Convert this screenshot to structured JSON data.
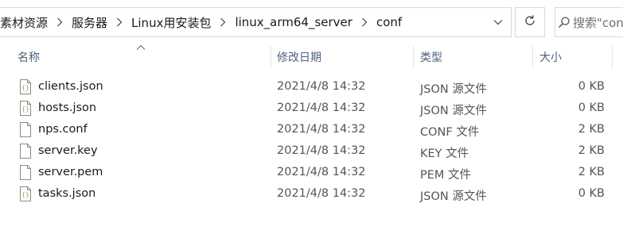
{
  "breadcrumb": {
    "items": [
      "素材资源",
      "服务器",
      "Linux用安装包",
      "linux_arm64_server",
      "conf"
    ]
  },
  "search": {
    "placeholder": "搜索\"conf\""
  },
  "columns": {
    "name": "名称",
    "date": "修改日期",
    "type": "类型",
    "size": "大小"
  },
  "files": [
    {
      "name": "clients.json",
      "date": "2021/4/8 14:32",
      "type": "JSON 源文件",
      "size": "0 KB",
      "icon": "json-file-icon"
    },
    {
      "name": "hosts.json",
      "date": "2021/4/8 14:32",
      "type": "JSON 源文件",
      "size": "0 KB",
      "icon": "json-file-icon"
    },
    {
      "name": "nps.conf",
      "date": "2021/4/8 14:32",
      "type": "CONF 文件",
      "size": "2 KB",
      "icon": "file-icon"
    },
    {
      "name": "server.key",
      "date": "2021/4/8 14:32",
      "type": "KEY 文件",
      "size": "2 KB",
      "icon": "file-icon"
    },
    {
      "name": "server.pem",
      "date": "2021/4/8 14:32",
      "type": "PEM 文件",
      "size": "2 KB",
      "icon": "file-icon"
    },
    {
      "name": "tasks.json",
      "date": "2021/4/8 14:32",
      "type": "JSON 源文件",
      "size": "0 KB",
      "icon": "json-file-icon"
    }
  ],
  "colors": {
    "header_text": "#4c607a",
    "border": "#d9d9d9",
    "json_icon": "#b5a424"
  }
}
